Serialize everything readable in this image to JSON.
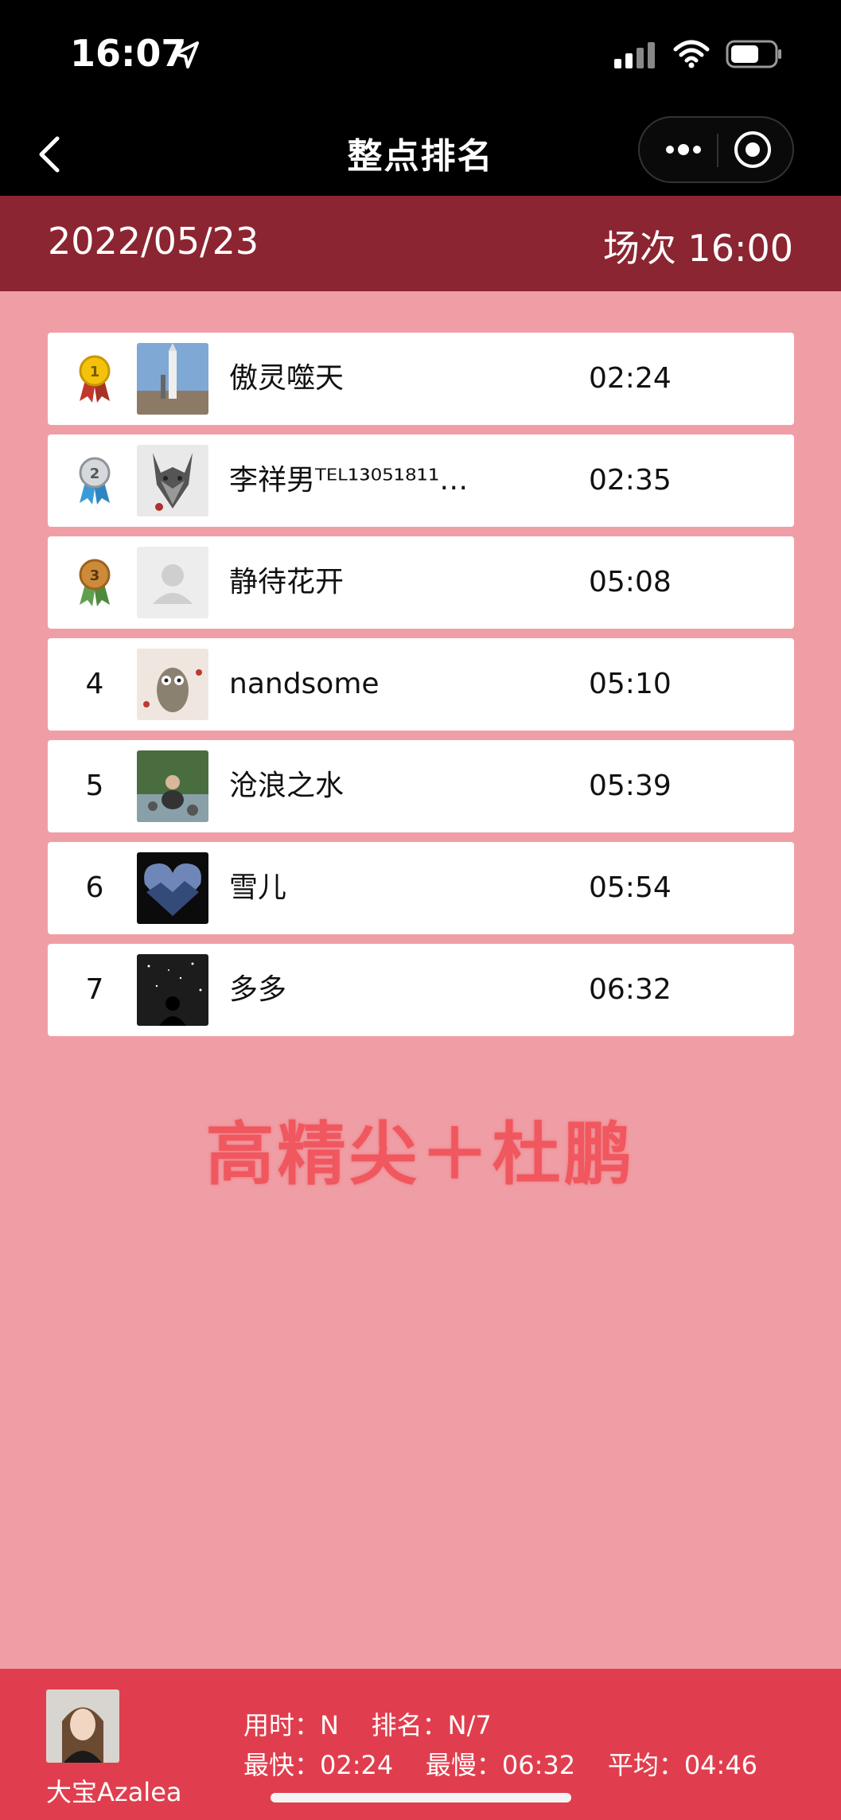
{
  "status_bar": {
    "time": "16:07"
  },
  "nav": {
    "title": "整点排名"
  },
  "header": {
    "date": "2022/05/23",
    "session": "场次 16:00"
  },
  "rankings": [
    {
      "rank": "1",
      "name": "傲灵噬天",
      "time": "02:24",
      "medal": "gold-medal-icon",
      "avatar": "rocket-launch-avatar"
    },
    {
      "rank": "2",
      "name": "李祥男ᵀᴱᴸ¹³⁰⁵¹⁸¹¹…",
      "time": "02:35",
      "medal": "silver-medal-icon",
      "avatar": "wolf-avatar"
    },
    {
      "rank": "3",
      "name": "静待花开",
      "time": "05:08",
      "medal": "bronze-medal-icon",
      "avatar": "default-avatar"
    },
    {
      "rank": "4",
      "name": "nandsome",
      "time": "05:10",
      "avatar": "owl-avatar"
    },
    {
      "rank": "5",
      "name": "沧浪之水",
      "time": "05:39",
      "avatar": "river-avatar"
    },
    {
      "rank": "6",
      "name": "雪儿",
      "time": "05:54",
      "avatar": "heart-mountains-avatar"
    },
    {
      "rank": "7",
      "name": "多多",
      "time": "06:32",
      "avatar": "starry-silhouette-avatar"
    }
  ],
  "watermark": "高精尖＋杜鹏",
  "footer": {
    "user_name": "大宝Azalea",
    "stats_line1": "用时：N    排名：N/7",
    "stats_line2": "最快：02:24    最慢：06:32    平均：04:46"
  },
  "colors": {
    "background": "#f09ea5",
    "header": "#8b2531",
    "footer": "#e03e4e",
    "watermark": "#f0575f"
  }
}
